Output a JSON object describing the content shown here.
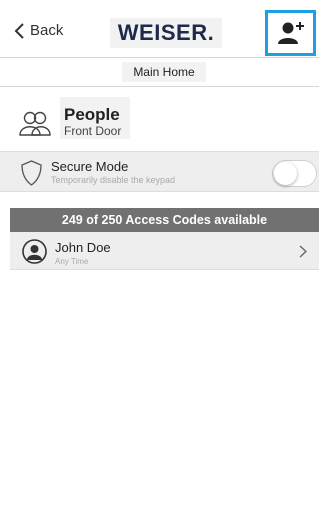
{
  "navbar": {
    "back_label": "Back",
    "logo_text": "WEISER.",
    "add_user_icon": "add-user-icon",
    "accent_color": "#1c9fe3"
  },
  "home": {
    "label": "Main Home"
  },
  "people": {
    "title": "People",
    "subtitle": "Front Door",
    "icon": "people-icon"
  },
  "secure_mode": {
    "title": "Secure Mode",
    "subtitle": "Temporarily disable the keypad",
    "icon": "shield-icon",
    "enabled": false
  },
  "access_codes": {
    "summary": "249 of 250 Access Codes available"
  },
  "users": [
    {
      "name": "John Doe",
      "schedule": "Any Time",
      "icon": "avatar-icon"
    }
  ]
}
